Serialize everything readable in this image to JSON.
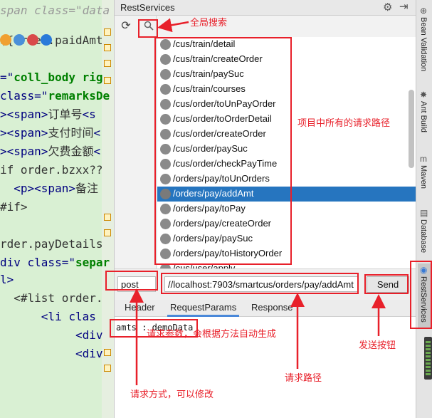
{
  "editor": {
    "lines": [
      {
        "parts": [
          {
            "cls": "ital",
            "t": "span class=\"data"
          }
        ]
      },
      {
        "parts": [
          {
            "cls": "ftl",
            "t": "${order.paidAmt"
          }
        ]
      },
      {
        "parts": [
          {
            "cls": "tag",
            "t": "=\""
          },
          {
            "cls": "str",
            "t": "coll_body rig"
          }
        ]
      },
      {
        "parts": [
          {
            "cls": "tag",
            "t": "class=\""
          },
          {
            "cls": "str",
            "t": "remarksDe"
          }
        ]
      },
      {
        "parts": [
          {
            "cls": "tag",
            "t": "><span>"
          },
          {
            "cls": "txt",
            "t": "订单号"
          },
          {
            "cls": "tag",
            "t": "<s"
          }
        ]
      },
      {
        "parts": [
          {
            "cls": "tag",
            "t": "><span>"
          },
          {
            "cls": "txt",
            "t": "支付时间"
          },
          {
            "cls": "tag",
            "t": "<"
          }
        ]
      },
      {
        "parts": [
          {
            "cls": "tag",
            "t": "><span>"
          },
          {
            "cls": "txt",
            "t": "欠费金额"
          },
          {
            "cls": "tag",
            "t": "<"
          }
        ]
      },
      {
        "parts": [
          {
            "cls": "ftl",
            "t": "if order.bzxx??"
          }
        ]
      },
      {
        "parts": [
          {
            "cls": "tag",
            "t": "  <p><span>"
          },
          {
            "cls": "txt",
            "t": "备注"
          }
        ]
      },
      {
        "parts": [
          {
            "cls": "ftl",
            "t": "#if>"
          }
        ]
      },
      {
        "parts": [
          {
            "cls": "ftl",
            "t": ""
          }
        ]
      },
      {
        "parts": [
          {
            "cls": "ftl",
            "t": "rder.payDetails"
          }
        ]
      },
      {
        "parts": [
          {
            "cls": "tag",
            "t": "div class=\""
          },
          {
            "cls": "str",
            "t": "separ"
          }
        ]
      },
      {
        "parts": [
          {
            "cls": "tag",
            "t": "l>"
          }
        ]
      },
      {
        "parts": [
          {
            "cls": "ftl",
            "t": "  <#list order."
          }
        ]
      },
      {
        "parts": [
          {
            "cls": "tag",
            "t": "      <li clas"
          }
        ]
      },
      {
        "parts": [
          {
            "cls": "tag",
            "t": "           <div"
          }
        ]
      },
      {
        "parts": [
          {
            "cls": "tag",
            "t": "           <div"
          }
        ]
      }
    ]
  },
  "panel": {
    "title": "RestServices",
    "gear_icon": "gear-icon",
    "minimize_icon": "minimize-icon",
    "refresh_icon": "refresh-icon",
    "search_icon": "search-icon"
  },
  "tree": {
    "items": [
      {
        "path": "/cus/train/detail"
      },
      {
        "path": "/cus/train/createOrder"
      },
      {
        "path": "/cus/train/paySuc"
      },
      {
        "path": "/cus/train/courses"
      },
      {
        "path": "/cus/order/toUnPayOrder"
      },
      {
        "path": "/cus/order/toOrderDetail"
      },
      {
        "path": "/cus/order/createOrder"
      },
      {
        "path": "/cus/order/paySuc"
      },
      {
        "path": "/cus/order/checkPayTime"
      },
      {
        "path": "/orders/pay/toUnOrders"
      },
      {
        "path": "/orders/pay/addAmt",
        "selected": true
      },
      {
        "path": "/orders/pay/toPay"
      },
      {
        "path": "/orders/pay/createOrder"
      },
      {
        "path": "/orders/pay/paySuc"
      },
      {
        "path": "/orders/pay/toHistoryOrder"
      },
      {
        "path": "/cus/user/apply"
      }
    ]
  },
  "request": {
    "method": "post",
    "url": "//localhost:7903/smartcus/orders/pay/addAmt",
    "send_label": "Send"
  },
  "tabs": [
    {
      "label": "Header"
    },
    {
      "label": "RequestParams",
      "active": true
    },
    {
      "label": "Response"
    }
  ],
  "params_text": "amts : demoData",
  "right_strip": [
    {
      "label": "Bean Validation",
      "icon": "bean-validation-icon"
    },
    {
      "label": "Ant Build",
      "icon": "ant-build-icon"
    },
    {
      "label": "Maven",
      "icon": "maven-icon"
    },
    {
      "label": "Database",
      "icon": "database-icon"
    },
    {
      "label": "RestServices",
      "icon": "rest-services-icon",
      "active": true
    }
  ],
  "annotations": {
    "global_search": "全局搜索",
    "all_paths": "项目中所有的请求路径",
    "send_button": "发送按钮",
    "params_note": "请求参数，会根据方法自动生成",
    "request_path": "请求路径",
    "method_note": "请求方式，可以修改"
  },
  "colors": {
    "selection": "#2675bf",
    "annotation_red": "#e8202a",
    "editor_bg": "#d9f0d3"
  }
}
